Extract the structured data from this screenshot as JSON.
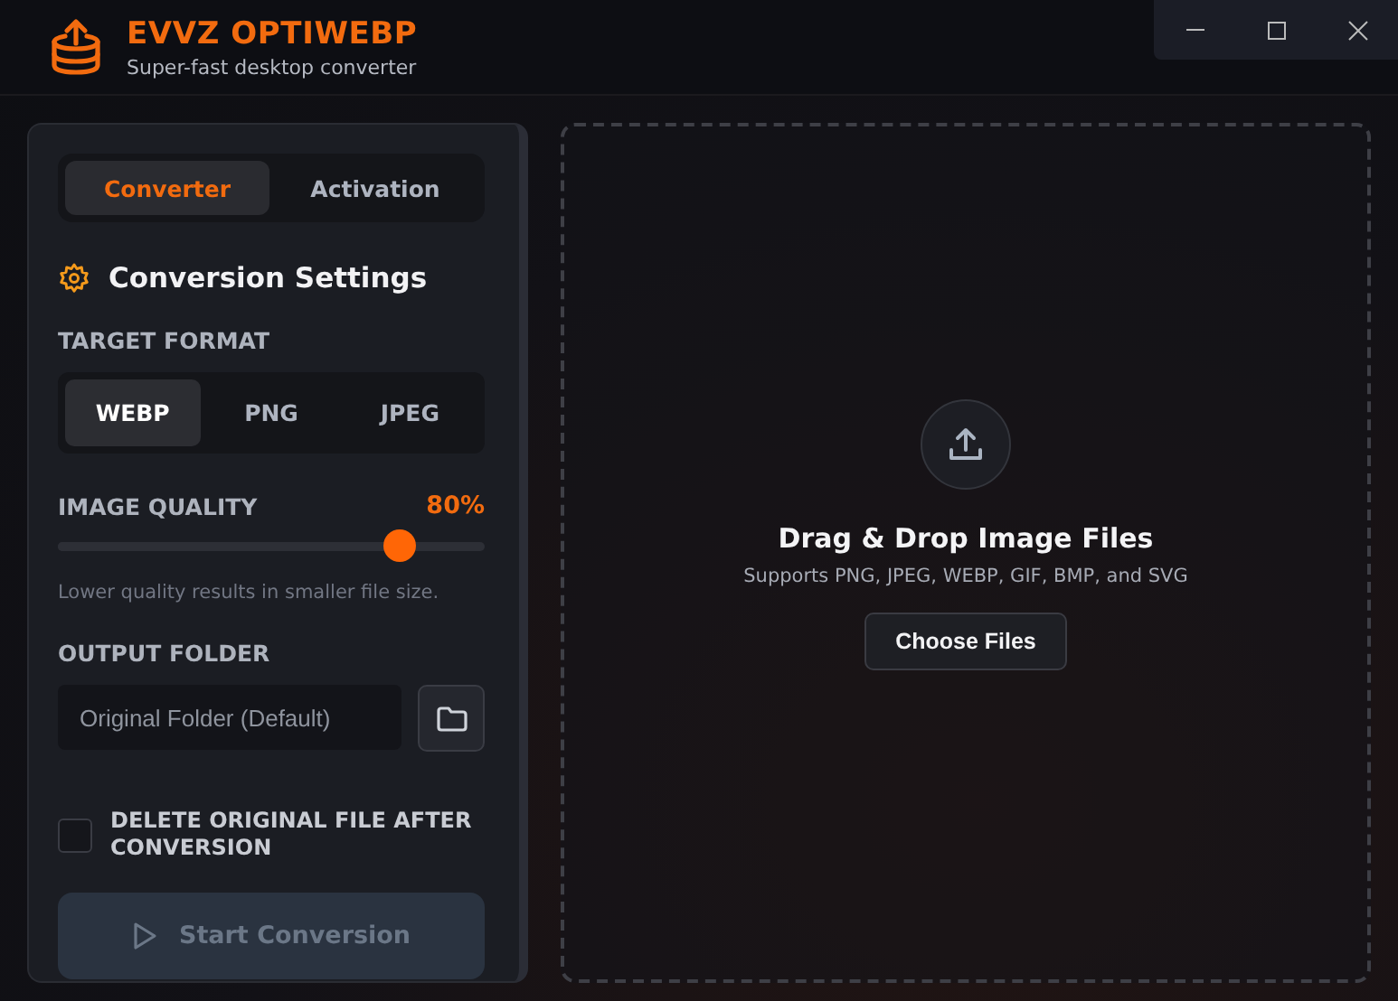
{
  "app": {
    "title": "EVVZ OPTIWEBP",
    "subtitle": "Super-fast desktop converter"
  },
  "tabs": [
    {
      "label": "Converter",
      "selected": true
    },
    {
      "label": "Activation",
      "selected": false
    }
  ],
  "settings": {
    "title": "Conversion Settings",
    "target_format": {
      "label": "TARGET FORMAT",
      "options": [
        {
          "label": "WEBP",
          "selected": true
        },
        {
          "label": "PNG",
          "selected": false
        },
        {
          "label": "JPEG",
          "selected": false
        }
      ]
    },
    "image_quality": {
      "label": "IMAGE QUALITY",
      "reading": "80%",
      "level": 0.8,
      "hint": "Lower quality results in smaller file size."
    },
    "output_folder": {
      "label": "OUTPUT FOLDER",
      "placeholder": "Original Folder (Default)"
    },
    "delete_original": {
      "label": "DELETE ORIGINAL FILE AFTER CONVERSION",
      "checked": false
    },
    "start_button": {
      "label": "Start Conversion",
      "disabled": true
    }
  },
  "drop_zone": {
    "title": "Drag & Drop Image Files",
    "subtitle": "Supports PNG, JPEG, WEBP, GIF, BMP, and SVG",
    "button": "Choose Files"
  }
}
